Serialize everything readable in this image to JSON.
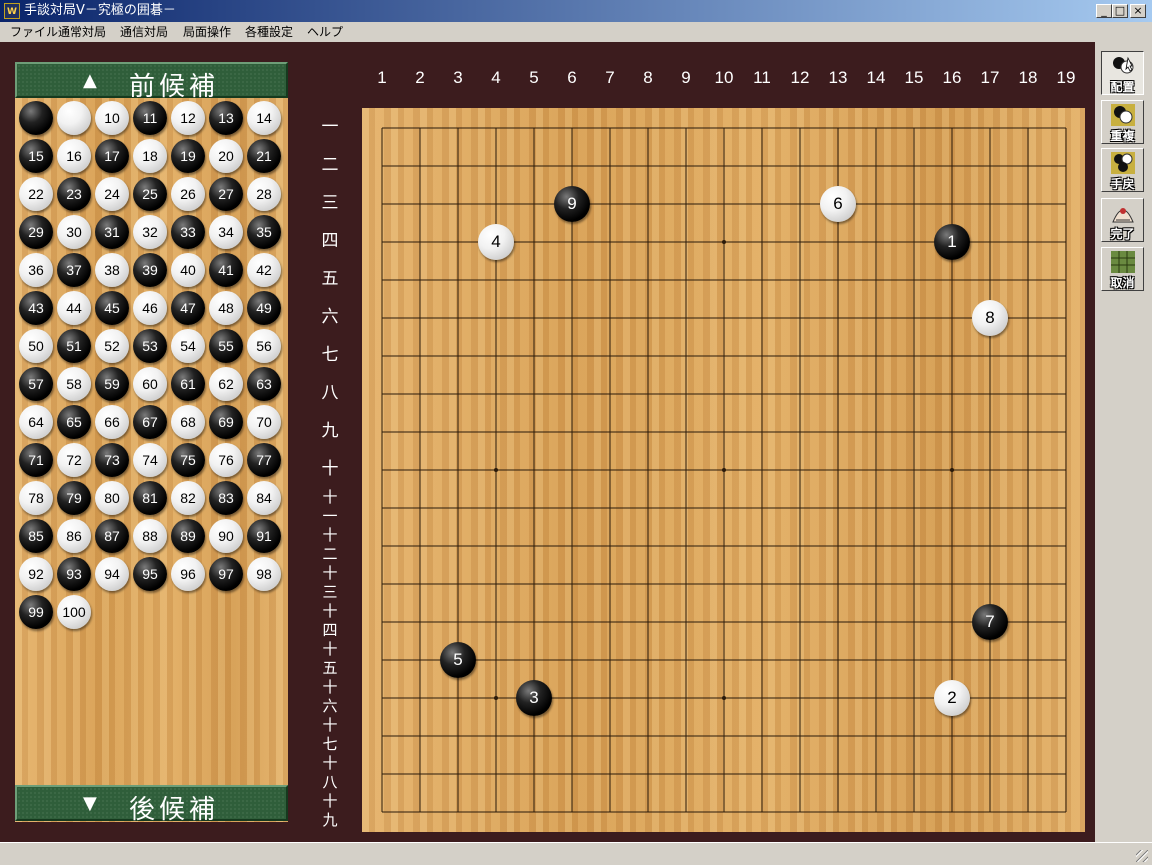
{
  "window": {
    "title": "手談対局Ⅴ－究極の囲碁－",
    "app_icon_text": "W",
    "controls": {
      "minimize": "_",
      "maximize": "□",
      "close": "×"
    }
  },
  "menu": [
    "ファイル",
    "通常対局",
    "通信対局",
    "局面操作",
    "各種設定",
    "ヘルプ"
  ],
  "candidates": {
    "prev_label": "前候補",
    "next_label": "後候補",
    "items": [
      {
        "color": "b",
        "label": ""
      },
      {
        "color": "w",
        "label": ""
      },
      {
        "color": "w",
        "label": "10"
      },
      {
        "color": "b",
        "label": "11"
      },
      {
        "color": "w",
        "label": "12"
      },
      {
        "color": "b",
        "label": "13"
      },
      {
        "color": "w",
        "label": "14"
      },
      {
        "color": "b",
        "label": "15"
      },
      {
        "color": "w",
        "label": "16"
      },
      {
        "color": "b",
        "label": "17"
      },
      {
        "color": "w",
        "label": "18"
      },
      {
        "color": "b",
        "label": "19"
      },
      {
        "color": "w",
        "label": "20"
      },
      {
        "color": "b",
        "label": "21"
      },
      {
        "color": "w",
        "label": "22"
      },
      {
        "color": "b",
        "label": "23"
      },
      {
        "color": "w",
        "label": "24"
      },
      {
        "color": "b",
        "label": "25"
      },
      {
        "color": "w",
        "label": "26"
      },
      {
        "color": "b",
        "label": "27"
      },
      {
        "color": "w",
        "label": "28"
      },
      {
        "color": "b",
        "label": "29"
      },
      {
        "color": "w",
        "label": "30"
      },
      {
        "color": "b",
        "label": "31"
      },
      {
        "color": "w",
        "label": "32"
      },
      {
        "color": "b",
        "label": "33"
      },
      {
        "color": "w",
        "label": "34"
      },
      {
        "color": "b",
        "label": "35"
      },
      {
        "color": "w",
        "label": "36"
      },
      {
        "color": "b",
        "label": "37"
      },
      {
        "color": "w",
        "label": "38"
      },
      {
        "color": "b",
        "label": "39"
      },
      {
        "color": "w",
        "label": "40"
      },
      {
        "color": "b",
        "label": "41"
      },
      {
        "color": "w",
        "label": "42"
      },
      {
        "color": "b",
        "label": "43"
      },
      {
        "color": "w",
        "label": "44"
      },
      {
        "color": "b",
        "label": "45"
      },
      {
        "color": "w",
        "label": "46"
      },
      {
        "color": "b",
        "label": "47"
      },
      {
        "color": "w",
        "label": "48"
      },
      {
        "color": "b",
        "label": "49"
      },
      {
        "color": "w",
        "label": "50"
      },
      {
        "color": "b",
        "label": "51"
      },
      {
        "color": "w",
        "label": "52"
      },
      {
        "color": "b",
        "label": "53"
      },
      {
        "color": "w",
        "label": "54"
      },
      {
        "color": "b",
        "label": "55"
      },
      {
        "color": "w",
        "label": "56"
      },
      {
        "color": "b",
        "label": "57"
      },
      {
        "color": "w",
        "label": "58"
      },
      {
        "color": "b",
        "label": "59"
      },
      {
        "color": "w",
        "label": "60"
      },
      {
        "color": "b",
        "label": "61"
      },
      {
        "color": "w",
        "label": "62"
      },
      {
        "color": "b",
        "label": "63"
      },
      {
        "color": "w",
        "label": "64"
      },
      {
        "color": "b",
        "label": "65"
      },
      {
        "color": "w",
        "label": "66"
      },
      {
        "color": "b",
        "label": "67"
      },
      {
        "color": "w",
        "label": "68"
      },
      {
        "color": "b",
        "label": "69"
      },
      {
        "color": "w",
        "label": "70"
      },
      {
        "color": "b",
        "label": "71"
      },
      {
        "color": "w",
        "label": "72"
      },
      {
        "color": "b",
        "label": "73"
      },
      {
        "color": "w",
        "label": "74"
      },
      {
        "color": "b",
        "label": "75"
      },
      {
        "color": "w",
        "label": "76"
      },
      {
        "color": "b",
        "label": "77"
      },
      {
        "color": "w",
        "label": "78"
      },
      {
        "color": "b",
        "label": "79"
      },
      {
        "color": "w",
        "label": "80"
      },
      {
        "color": "b",
        "label": "81"
      },
      {
        "color": "w",
        "label": "82"
      },
      {
        "color": "b",
        "label": "83"
      },
      {
        "color": "w",
        "label": "84"
      },
      {
        "color": "b",
        "label": "85"
      },
      {
        "color": "w",
        "label": "86"
      },
      {
        "color": "b",
        "label": "87"
      },
      {
        "color": "w",
        "label": "88"
      },
      {
        "color": "b",
        "label": "89"
      },
      {
        "color": "w",
        "label": "90"
      },
      {
        "color": "b",
        "label": "91"
      },
      {
        "color": "w",
        "label": "92"
      },
      {
        "color": "b",
        "label": "93"
      },
      {
        "color": "w",
        "label": "94"
      },
      {
        "color": "b",
        "label": "95"
      },
      {
        "color": "w",
        "label": "96"
      },
      {
        "color": "b",
        "label": "97"
      },
      {
        "color": "w",
        "label": "98"
      },
      {
        "color": "b",
        "label": "99"
      },
      {
        "color": "w",
        "label": "100"
      }
    ]
  },
  "board": {
    "size": 19,
    "columns": [
      "1",
      "2",
      "3",
      "4",
      "5",
      "6",
      "7",
      "8",
      "9",
      "10",
      "11",
      "12",
      "13",
      "14",
      "15",
      "16",
      "17",
      "18",
      "19"
    ],
    "rows": [
      "一",
      "二",
      "三",
      "四",
      "五",
      "六",
      "七",
      "八",
      "九",
      "十",
      "十一",
      "十二",
      "十三",
      "十四",
      "十五",
      "十六",
      "十七",
      "十八",
      "十九"
    ],
    "stones": [
      {
        "move": "1",
        "color": "b",
        "col": 16,
        "row": 4
      },
      {
        "move": "2",
        "color": "w",
        "col": 16,
        "row": 16
      },
      {
        "move": "3",
        "color": "b",
        "col": 5,
        "row": 16
      },
      {
        "move": "4",
        "color": "w",
        "col": 4,
        "row": 4
      },
      {
        "move": "5",
        "color": "b",
        "col": 3,
        "row": 15
      },
      {
        "move": "6",
        "color": "w",
        "col": 13,
        "row": 3
      },
      {
        "move": "7",
        "color": "b",
        "col": 17,
        "row": 14
      },
      {
        "move": "8",
        "color": "w",
        "col": 17,
        "row": 6
      },
      {
        "move": "9",
        "color": "b",
        "col": 6,
        "row": 3
      }
    ]
  },
  "toolbar": [
    {
      "id": "place",
      "label": "配置",
      "icon": "place-stones-icon",
      "active": true
    },
    {
      "id": "overlap",
      "label": "重複",
      "icon": "overlap-icon",
      "active": false
    },
    {
      "id": "undo",
      "label": "手戻",
      "icon": "undo-move-icon",
      "active": false
    },
    {
      "id": "done",
      "label": "完了",
      "icon": "done-icon",
      "active": false
    },
    {
      "id": "cancel",
      "label": "取消",
      "icon": "cancel-icon",
      "active": false
    }
  ],
  "colors": {
    "frame": "#3c1c1e",
    "board_wood": "#d9a35c",
    "candidate_button": "#2f5e3a",
    "grid_line": "#2a1a0a"
  }
}
